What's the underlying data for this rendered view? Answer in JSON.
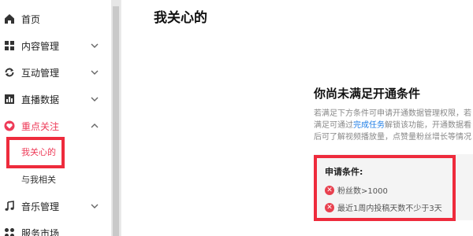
{
  "sidebar": {
    "items": [
      {
        "label": "首页",
        "icon": "home-icon"
      },
      {
        "label": "内容管理",
        "icon": "grid-icon"
      },
      {
        "label": "互动管理",
        "icon": "refresh-icon"
      },
      {
        "label": "直播数据",
        "icon": "bar-chart-icon"
      },
      {
        "label": "重点关注",
        "icon": "heart-icon"
      },
      {
        "label": "音乐管理",
        "icon": "music-note-icon"
      },
      {
        "label": "服务市场",
        "icon": "apps-icon"
      }
    ],
    "sub_items": [
      {
        "label": "我关心的"
      },
      {
        "label": "与我相关"
      }
    ]
  },
  "main": {
    "title": "我关心的",
    "notice": {
      "title": "你尚未满足开通条件",
      "line1": "若满足下方条件可申请开通数据管理权限，若",
      "line2_pre": "满足可通过",
      "line2_link": "完成任务",
      "line2_post": "解锁该功能，开通数据看",
      "line3": "后可了解视频播放量，点赞量粉丝增长等情况"
    },
    "conditions": {
      "title": "申请条件:",
      "items": [
        {
          "text": "粉丝数>1000"
        },
        {
          "text": "最近1周内投稿天数不少于3天"
        }
      ]
    }
  },
  "colors": {
    "accent": "#ee3b58",
    "highlight": "#ee2b3c",
    "link": "#1f7ee6",
    "fail": "#e8414f"
  }
}
